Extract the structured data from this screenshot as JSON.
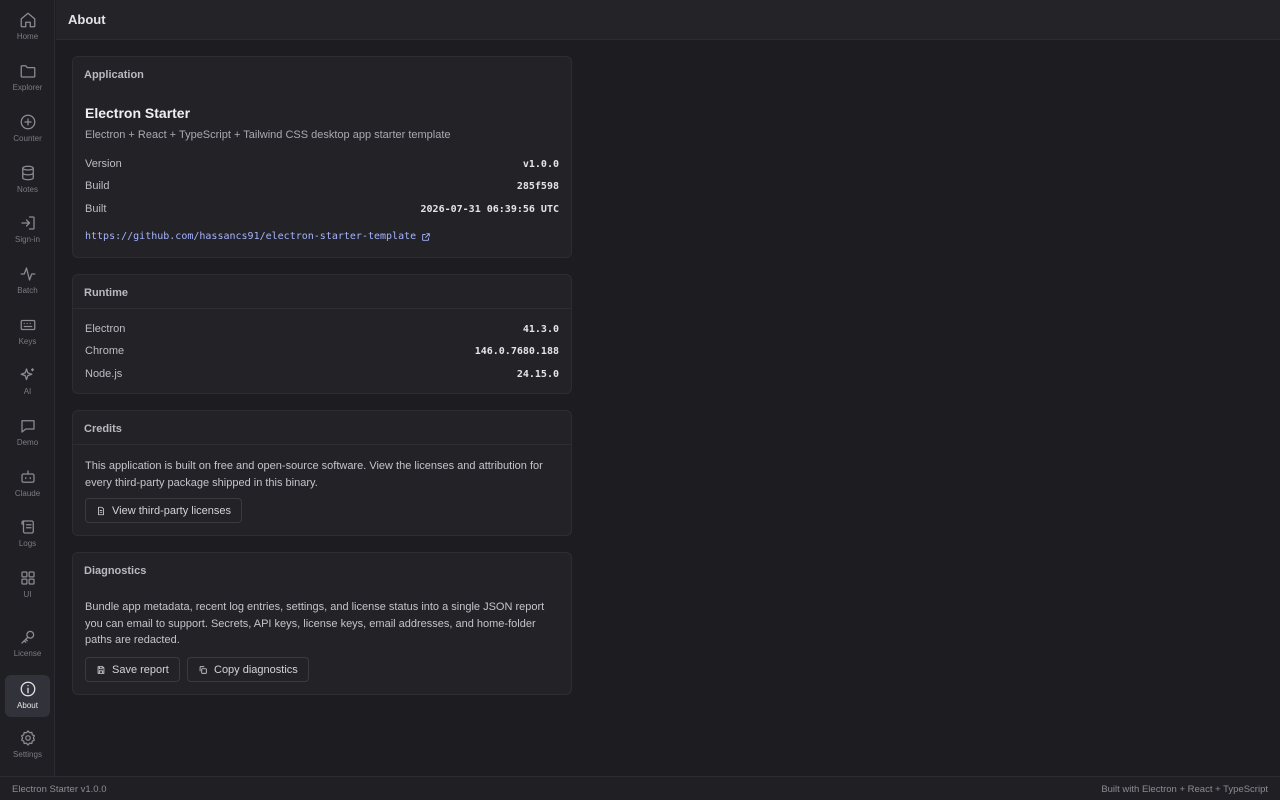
{
  "page_title": "About",
  "sidebar": {
    "items": [
      {
        "label": "Home",
        "icon": "home-icon"
      },
      {
        "label": "Explorer",
        "icon": "folder-icon"
      },
      {
        "label": "Counter",
        "icon": "plus-circle-icon"
      },
      {
        "label": "Notes",
        "icon": "database-icon"
      },
      {
        "label": "Sign-in",
        "icon": "sign-in-icon"
      },
      {
        "label": "Batch",
        "icon": "activity-icon"
      },
      {
        "label": "Keys",
        "icon": "keyboard-icon"
      },
      {
        "label": "AI",
        "icon": "sparkles-icon"
      },
      {
        "label": "Demo",
        "icon": "message-square-icon"
      },
      {
        "label": "Claude",
        "icon": "bot-icon"
      },
      {
        "label": "Logs",
        "icon": "scroll-icon"
      },
      {
        "label": "UI",
        "icon": "grid-icon"
      },
      {
        "label": "License",
        "icon": "key-icon"
      },
      {
        "label": "About",
        "icon": "info-icon"
      },
      {
        "label": "Settings",
        "icon": "gear-icon"
      }
    ],
    "active": "About"
  },
  "application": {
    "heading": "Application",
    "name": "Electron Starter",
    "description": "Electron + React + TypeScript + Tailwind CSS desktop app starter template",
    "version_label": "Version",
    "version": "v1.0.0",
    "build_label": "Build",
    "build": "285f598",
    "built_label": "Built",
    "built": "2026-07-31 06:39:56 UTC",
    "repo_url": "https://github.com/hassancs91/electron-starter-template"
  },
  "runtime": {
    "heading": "Runtime",
    "electron_label": "Electron",
    "electron": "41.3.0",
    "chrome_label": "Chrome",
    "chrome": "146.0.7680.188",
    "node_label": "Node.js",
    "node": "24.15.0"
  },
  "credits": {
    "heading": "Credits",
    "text": "This application is built on free and open-source software. View the licenses and attribution for every third-party package shipped in this binary.",
    "button": "View third-party licenses"
  },
  "diagnostics": {
    "heading": "Diagnostics",
    "text": "Bundle app metadata, recent log entries, settings, and license status into a single JSON report you can email to support. Secrets, API keys, license keys, email addresses, and home-folder paths are redacted.",
    "save_button": "Save report",
    "copy_button": "Copy diagnostics"
  },
  "statusbar": {
    "left": "Electron Starter v1.0.0",
    "right": "Built with Electron + React + TypeScript"
  }
}
